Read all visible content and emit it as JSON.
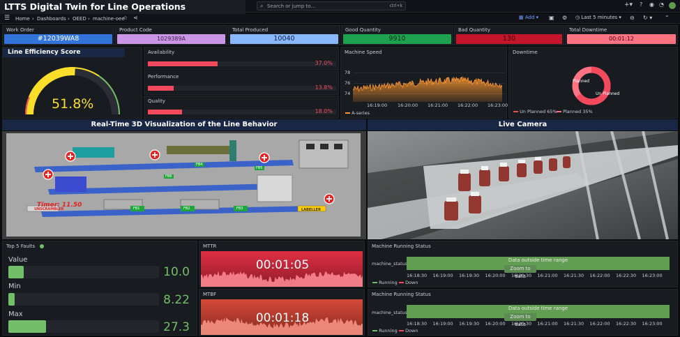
{
  "title": "LTTS Digital Twin for Line Operations",
  "topbar": {
    "search_placeholder": "Search or jump to...",
    "search_shortcut": "ctrl+k"
  },
  "nav": {
    "breadcrumbs": [
      "Home",
      "Dashboards",
      "OEED",
      "machine-oee"
    ],
    "add_label": "Add",
    "time_range": "Last 5 minutes"
  },
  "stats": [
    {
      "label": "Work Order",
      "value": "#12039WA8",
      "bg": "#3274d9",
      "fg": "#ffffff"
    },
    {
      "label": "Product Code",
      "value": "1029389A",
      "bg": "#ca95e5",
      "fg": "#3b1d4a"
    },
    {
      "label": "Total Produced",
      "value": "10040",
      "bg": "#8ab8ff",
      "fg": "#0b1f44"
    },
    {
      "label": "Good Quantity",
      "value": "9910",
      "bg": "#1fa24f",
      "fg": "#062a12"
    },
    {
      "label": "Bad Quantity",
      "value": "130",
      "bg": "#c4162a",
      "fg": "#3d0008"
    },
    {
      "label": "Total Downtime",
      "value": "00:01:12",
      "bg": "#ff7383",
      "fg": "#3d0008"
    }
  ],
  "efficiency": {
    "title": "Line Efficiency Score",
    "value": "51.8%",
    "fraction": 0.518
  },
  "availability": {
    "label": "Availability",
    "value": "37.0%",
    "fraction": 0.37
  },
  "performance": {
    "label": "Performance",
    "value": "13.8%",
    "fraction": 0.138
  },
  "quality": {
    "label": "Quality",
    "value": "18.0%",
    "fraction": 0.18
  },
  "machine_speed": {
    "title": "Machine Speed",
    "y_ticks": [
      "78",
      "76",
      "74"
    ],
    "x_ticks": [
      "16:19:00",
      "16:20:00",
      "16:21:00",
      "16:22:00",
      "16:23:00"
    ],
    "legend": "A-series",
    "color": "#ff9830"
  },
  "downtime": {
    "title": "Downtime",
    "legend": [
      "Un Planned 65%",
      "Planned 35%"
    ],
    "labels": [
      "Planned",
      "Un Planned"
    ],
    "colors": [
      "#f2495c",
      "#ff7383"
    ],
    "unplanned_fraction": 0.65
  },
  "visualization": {
    "title": "Real-Time 3D Visualization of the Line Behavior",
    "timer": "Timer: 11.50",
    "labels": [
      "UNSCRAMBLER",
      "LABELLER",
      "FB1",
      "FB2",
      "FB3",
      "FB4",
      "FB5",
      "FB6"
    ]
  },
  "camera": {
    "title": "Live Camera"
  },
  "faults": {
    "title": "Top 5 Faults",
    "rows": [
      {
        "label": "Value",
        "value": "10.0",
        "fraction": 0.1
      },
      {
        "label": "Min",
        "value": "8.22",
        "fraction": 0.04
      },
      {
        "label": "Max",
        "value": "27.3",
        "fraction": 0.25
      }
    ]
  },
  "mttr": {
    "title": "MTTR",
    "value": "00:01:05"
  },
  "mtbf": {
    "title": "MTBF",
    "value": "00:01:18"
  },
  "running_status": [
    {
      "title": "Machine Running Status",
      "series": "machine_status",
      "overlay": "Data outside time range",
      "zoom": "Zoom to data",
      "x_ticks": [
        "16:18:30",
        "16:19:00",
        "16:19:30",
        "16:20:00",
        "16:20:30",
        "16:21:00",
        "16:21:30",
        "16:22:00",
        "16:22:30",
        "16:23:00"
      ],
      "legend": [
        "Running",
        "Down"
      ]
    },
    {
      "title": "Machine Running Status",
      "series": "machine_status",
      "overlay": "Data outside time range",
      "zoom": "Zoom to data",
      "x_ticks": [
        "16:18:30",
        "16:19:00",
        "16:19:30",
        "16:20:00",
        "16:20:30",
        "16:21:00",
        "16:21:30",
        "16:22:00",
        "16:22:30",
        "16:23:00"
      ],
      "legend": [
        "Running",
        "Down"
      ]
    }
  ]
}
